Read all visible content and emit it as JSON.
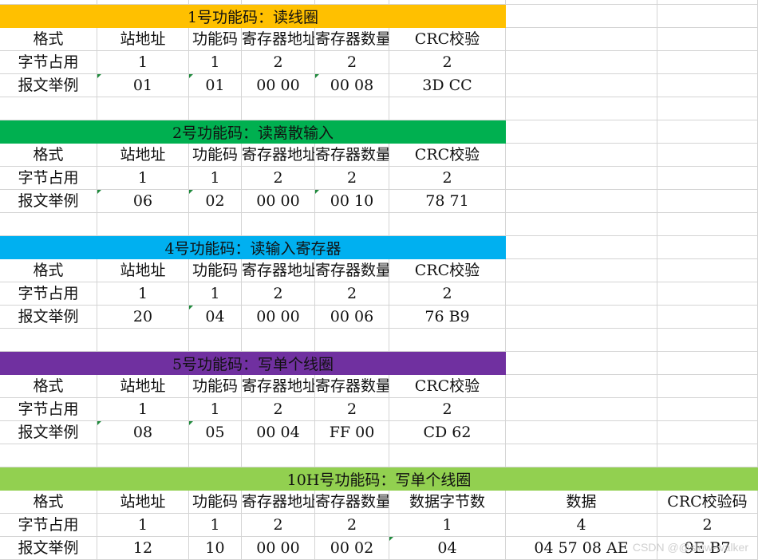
{
  "labels": {
    "format": "格式",
    "bytes": "字节占用",
    "example": "报文举例"
  },
  "colors": {
    "fc1": "#FFC000",
    "fc2": "#00B050",
    "fc4": "#00B0F0",
    "fc5": "#7030A0",
    "fc10h": "#92D050",
    "grid": "#D4D4D4"
  },
  "blocks": [
    {
      "title": "1号功能码：读线圈",
      "headers": [
        "站地址",
        "功能码",
        "寄存器地址",
        "寄存器数量",
        "CRC校验"
      ],
      "bytes": [
        "1",
        "1",
        "2",
        "2",
        "2"
      ],
      "example": [
        "01",
        "01",
        "00 00",
        "00 08",
        "3D CC"
      ]
    },
    {
      "title": "2号功能码：读离散输入",
      "headers": [
        "站地址",
        "功能码",
        "寄存器地址",
        "寄存器数量",
        "CRC校验"
      ],
      "bytes": [
        "1",
        "1",
        "2",
        "2",
        "2"
      ],
      "example": [
        "06",
        "02",
        "00 00",
        "00 10",
        "78 71"
      ]
    },
    {
      "title": "4号功能码：读输入寄存器",
      "headers": [
        "站地址",
        "功能码",
        "寄存器地址",
        "寄存器数量",
        "CRC校验"
      ],
      "bytes": [
        "1",
        "1",
        "2",
        "2",
        "2"
      ],
      "example": [
        "20",
        "04",
        "00 00",
        "00 06",
        "76 B9"
      ]
    },
    {
      "title": "5号功能码：写单个线圈",
      "headers": [
        "站地址",
        "功能码",
        "寄存器地址",
        "寄存器数量",
        "CRC校验"
      ],
      "bytes": [
        "1",
        "1",
        "2",
        "2",
        "2"
      ],
      "example": [
        "08",
        "05",
        "00 04",
        "FF 00",
        "CD 62"
      ]
    },
    {
      "title": "10H号功能码：写单个线圈",
      "headers": [
        "站地址",
        "功能码",
        "寄存器地址",
        "寄存器数量",
        "数据字节数",
        "数据",
        "CRC校验码"
      ],
      "bytes": [
        "1",
        "1",
        "2",
        "2",
        "1",
        "4",
        "2"
      ],
      "example": [
        "12",
        "10",
        "00 00",
        "00 02",
        "04",
        "04 57 08 AE",
        "9E B7"
      ]
    }
  ],
  "watermark": "CSDN @@slow-walker"
}
